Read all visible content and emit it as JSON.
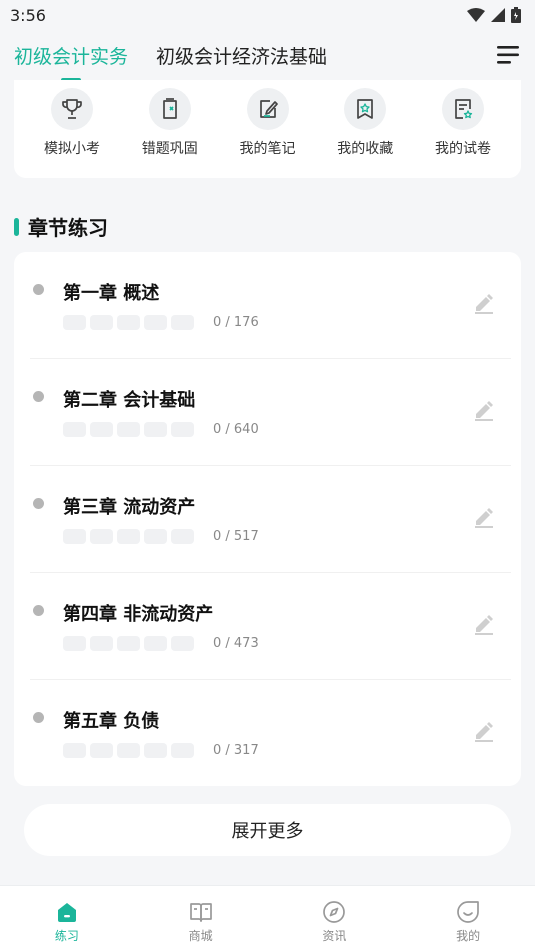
{
  "status_bar": {
    "time": "3:56"
  },
  "header": {
    "tabs": [
      {
        "label": "初级会计实务",
        "active": true
      },
      {
        "label": "初级会计经济法基础",
        "active": false
      }
    ]
  },
  "quick_actions": [
    {
      "label": "模拟小考",
      "icon": "trophy-icon"
    },
    {
      "label": "错题巩固",
      "icon": "wrong-question-icon"
    },
    {
      "label": "我的笔记",
      "icon": "note-icon"
    },
    {
      "label": "我的收藏",
      "icon": "favorite-icon"
    },
    {
      "label": "我的试卷",
      "icon": "paper-icon"
    }
  ],
  "section": {
    "title": "章节练习"
  },
  "chapters": [
    {
      "title": "第一章 概述",
      "progress": "0 / 176"
    },
    {
      "title": "第二章 会计基础",
      "progress": "0 / 640"
    },
    {
      "title": "第三章 流动资产",
      "progress": "0 / 517"
    },
    {
      "title": "第四章 非流动资产",
      "progress": "0 / 473"
    },
    {
      "title": "第五章 负债",
      "progress": "0 / 317"
    }
  ],
  "expand": {
    "label": "展开更多"
  },
  "bottom_nav": [
    {
      "label": "练习",
      "icon": "home-icon",
      "active": true
    },
    {
      "label": "商城",
      "icon": "book-icon",
      "active": false
    },
    {
      "label": "资讯",
      "icon": "compass-icon",
      "active": false
    },
    {
      "label": "我的",
      "icon": "smile-icon",
      "active": false
    }
  ],
  "colors": {
    "accent": "#1bb59a",
    "background": "#f5f6f8",
    "dot": "#b5b5b5"
  }
}
